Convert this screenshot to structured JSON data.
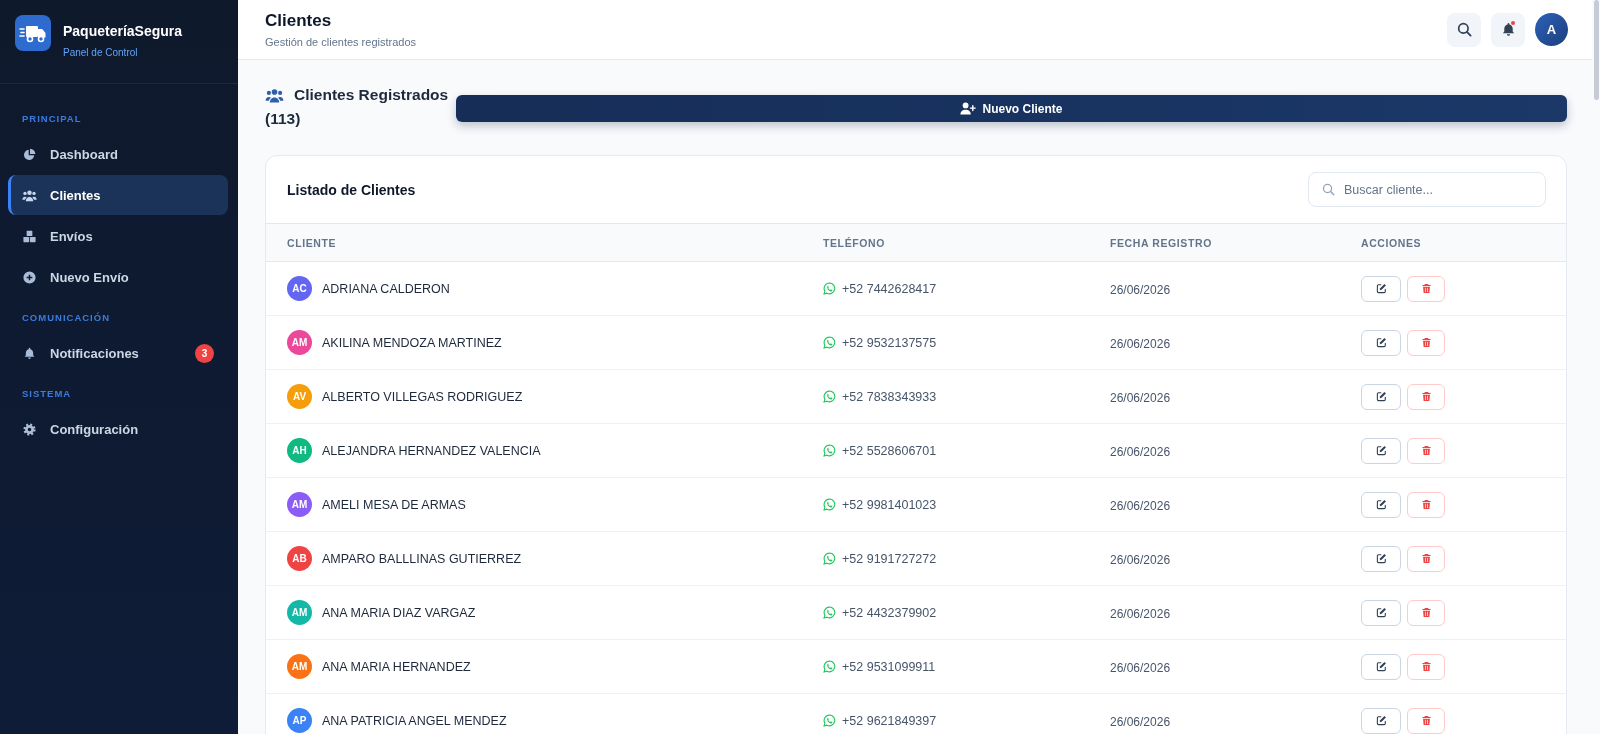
{
  "sidebar": {
    "brand": {
      "name": "PaqueteríaSegura",
      "subtitle": "Panel de Control"
    },
    "sections": [
      {
        "title": "PRINCIPAL",
        "items": [
          {
            "label": "Dashboard",
            "selected": false
          },
          {
            "label": "Clientes",
            "selected": true
          },
          {
            "label": "Envíos",
            "selected": false
          },
          {
            "label": "Nuevo Envío",
            "selected": false
          }
        ]
      },
      {
        "title": "COMUNICACIÓN",
        "items": [
          {
            "label": "Notificaciones",
            "selected": false,
            "badge": "3"
          }
        ]
      },
      {
        "title": "SISTEMA",
        "items": [
          {
            "label": "Configuración",
            "selected": false
          }
        ]
      }
    ]
  },
  "header": {
    "title": "Clientes",
    "subtitle": "Gestión de clientes registrados",
    "bell": {
      "unread": true
    },
    "avatar": "A"
  },
  "section": {
    "title": "Clientes Registrados",
    "count": "(113)",
    "button": "Nuevo Cliente"
  },
  "clients_card": {
    "title": "Listado de Clientes",
    "search": {
      "placeholder": "Buscar cliente..."
    },
    "table": {
      "columns": [
        "CLIENTE",
        "TELÉFONO",
        "FECHA REGISTRO",
        "ACCIONES"
      ],
      "rows": [
        {
          "initials": "AC",
          "color": "#6366f1",
          "name": "ADRIANA CALDERON",
          "phone": "+52 7442628417",
          "date": "26/06/2026"
        },
        {
          "initials": "AM",
          "color": "#ec4899",
          "name": "AKILINA MENDOZA MARTINEZ",
          "phone": "+52 9532137575",
          "date": "26/06/2026"
        },
        {
          "initials": "AV",
          "color": "#f59e0b",
          "name": "ALBERTO VILLEGAS RODRIGUEZ",
          "phone": "+52 7838343933",
          "date": "26/06/2026"
        },
        {
          "initials": "AH",
          "color": "#10b981",
          "name": "ALEJANDRA HERNANDEZ VALENCIA",
          "phone": "+52 5528606701",
          "date": "26/06/2026"
        },
        {
          "initials": "AM",
          "color": "#8b5cf6",
          "name": "AMELI MESA DE ARMAS",
          "phone": "+52 9981401023",
          "date": "26/06/2026"
        },
        {
          "initials": "AB",
          "color": "#ef4444",
          "name": "AMPARO BALLLINAS GUTIERREZ",
          "phone": "+52 9191727272",
          "date": "26/06/2026"
        },
        {
          "initials": "AM",
          "color": "#14b8a6",
          "name": "ANA MARIA DIAZ VARGAZ",
          "phone": "+52 4432379902",
          "date": "26/06/2026"
        },
        {
          "initials": "AM",
          "color": "#f97316",
          "name": "ANA MARIA HERNANDEZ",
          "phone": "+52 9531099911",
          "date": "26/06/2026"
        },
        {
          "initials": "AP",
          "color": "#3b82f6",
          "name": "ANA PATRICIA ANGEL MENDEZ",
          "phone": "+52 9621849397",
          "date": "26/06/2026"
        }
      ]
    }
  }
}
